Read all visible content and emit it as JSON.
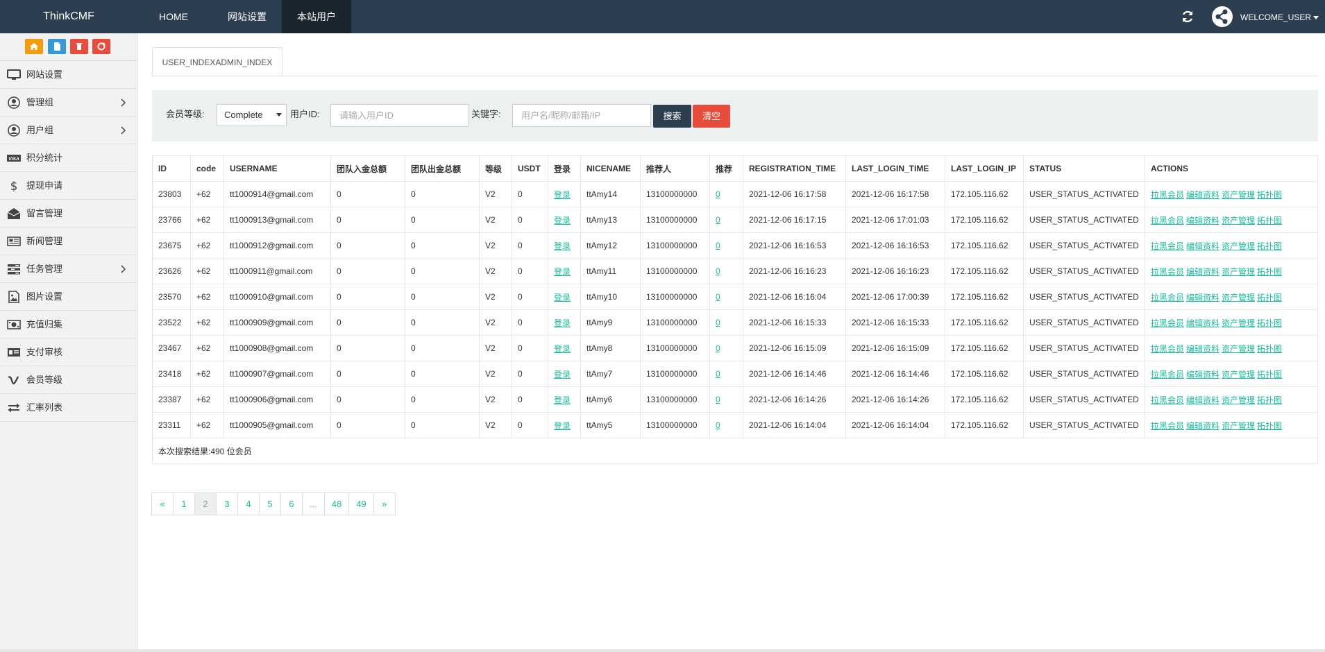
{
  "navbar": {
    "brand": "ThinkCMF",
    "items": [
      {
        "label": "HOME"
      },
      {
        "label": "网站设置"
      },
      {
        "label": "本站用户"
      }
    ],
    "welcome": "WELCOME_USER"
  },
  "shortcuts": [
    {
      "icon": "home-icon",
      "color": "#f39c12"
    },
    {
      "icon": "file-icon",
      "color": "#3498db"
    },
    {
      "icon": "trash-icon",
      "color": "#e74c3c"
    },
    {
      "icon": "recycle-icon",
      "color": "#e74c3c"
    }
  ],
  "sidebar": {
    "items": [
      {
        "label": "网站设置",
        "icon": "monitor-icon"
      },
      {
        "label": "管理组",
        "icon": "user-circle-icon"
      },
      {
        "label": "用户组",
        "icon": "user-circle-icon"
      },
      {
        "label": "积分统计",
        "icon": "visa-icon"
      },
      {
        "label": "提现申请",
        "icon": "dollar-icon"
      },
      {
        "label": "留言管理",
        "icon": "envelope-open-icon"
      },
      {
        "label": "新闻管理",
        "icon": "newspaper-icon"
      },
      {
        "label": "任务管理",
        "icon": "tasks-icon"
      },
      {
        "label": "图片设置",
        "icon": "image-icon"
      },
      {
        "label": "充值归集",
        "icon": "money-icon"
      },
      {
        "label": "支付审核",
        "icon": "id-card-icon"
      },
      {
        "label": "会员等级",
        "icon": "vimeo-icon"
      },
      {
        "label": "汇率列表",
        "icon": "exchange-icon"
      }
    ]
  },
  "tab": {
    "label": "USER_INDEXADMIN_INDEX"
  },
  "filter": {
    "level_label": "会员等级:",
    "level_value": "Complete",
    "userid_label": "用户ID:",
    "userid_placeholder": "请输入用户ID",
    "keyword_label": "关键字:",
    "keyword_placeholder": "用户名/昵称/邮箱/IP",
    "search_label": "搜索",
    "clear_label": "清空"
  },
  "table": {
    "headers": [
      "ID",
      "code",
      "USERNAME",
      "团队入金总额",
      "团队出金总额",
      "等级",
      "USDT",
      "登录",
      "NICENAME",
      "推荐人",
      "推荐",
      "REGISTRATION_TIME",
      "LAST_LOGIN_TIME",
      "LAST_LOGIN_IP",
      "STATUS",
      "ACTIONS"
    ],
    "login_link": "登录",
    "actions": [
      "拉黑会员",
      "编辑资料",
      "资产管理",
      "拓扑图"
    ],
    "rows": [
      {
        "id": "23803",
        "code": "+62",
        "username": "tt1000914@gmail.com",
        "team_in": "0",
        "team_out": "0",
        "level": "V2",
        "usdt": "0",
        "nicename": "ttAmy14",
        "referrer": "13100000000",
        "referrals": "0",
        "reg_time": "2021-12-06 16:17:58",
        "last_login": "2021-12-06 16:17:58",
        "ip": "172.105.116.62",
        "status": "USER_STATUS_ACTIVATED"
      },
      {
        "id": "23766",
        "code": "+62",
        "username": "tt1000913@gmail.com",
        "team_in": "0",
        "team_out": "0",
        "level": "V2",
        "usdt": "0",
        "nicename": "ttAmy13",
        "referrer": "13100000000",
        "referrals": "0",
        "reg_time": "2021-12-06 16:17:15",
        "last_login": "2021-12-06 17:01:03",
        "ip": "172.105.116.62",
        "status": "USER_STATUS_ACTIVATED"
      },
      {
        "id": "23675",
        "code": "+62",
        "username": "tt1000912@gmail.com",
        "team_in": "0",
        "team_out": "0",
        "level": "V2",
        "usdt": "0",
        "nicename": "ttAmy12",
        "referrer": "13100000000",
        "referrals": "0",
        "reg_time": "2021-12-06 16:16:53",
        "last_login": "2021-12-06 16:16:53",
        "ip": "172.105.116.62",
        "status": "USER_STATUS_ACTIVATED"
      },
      {
        "id": "23626",
        "code": "+62",
        "username": "tt1000911@gmail.com",
        "team_in": "0",
        "team_out": "0",
        "level": "V2",
        "usdt": "0",
        "nicename": "ttAmy11",
        "referrer": "13100000000",
        "referrals": "0",
        "reg_time": "2021-12-06 16:16:23",
        "last_login": "2021-12-06 16:16:23",
        "ip": "172.105.116.62",
        "status": "USER_STATUS_ACTIVATED"
      },
      {
        "id": "23570",
        "code": "+62",
        "username": "tt1000910@gmail.com",
        "team_in": "0",
        "team_out": "0",
        "level": "V2",
        "usdt": "0",
        "nicename": "ttAmy10",
        "referrer": "13100000000",
        "referrals": "0",
        "reg_time": "2021-12-06 16:16:04",
        "last_login": "2021-12-06 17:00:39",
        "ip": "172.105.116.62",
        "status": "USER_STATUS_ACTIVATED"
      },
      {
        "id": "23522",
        "code": "+62",
        "username": "tt1000909@gmail.com",
        "team_in": "0",
        "team_out": "0",
        "level": "V2",
        "usdt": "0",
        "nicename": "ttAmy9",
        "referrer": "13100000000",
        "referrals": "0",
        "reg_time": "2021-12-06 16:15:33",
        "last_login": "2021-12-06 16:15:33",
        "ip": "172.105.116.62",
        "status": "USER_STATUS_ACTIVATED"
      },
      {
        "id": "23467",
        "code": "+62",
        "username": "tt1000908@gmail.com",
        "team_in": "0",
        "team_out": "0",
        "level": "V2",
        "usdt": "0",
        "nicename": "ttAmy8",
        "referrer": "13100000000",
        "referrals": "0",
        "reg_time": "2021-12-06 16:15:09",
        "last_login": "2021-12-06 16:15:09",
        "ip": "172.105.116.62",
        "status": "USER_STATUS_ACTIVATED"
      },
      {
        "id": "23418",
        "code": "+62",
        "username": "tt1000907@gmail.com",
        "team_in": "0",
        "team_out": "0",
        "level": "V2",
        "usdt": "0",
        "nicename": "ttAmy7",
        "referrer": "13100000000",
        "referrals": "0",
        "reg_time": "2021-12-06 16:14:46",
        "last_login": "2021-12-06 16:14:46",
        "ip": "172.105.116.62",
        "status": "USER_STATUS_ACTIVATED"
      },
      {
        "id": "23387",
        "code": "+62",
        "username": "tt1000906@gmail.com",
        "team_in": "0",
        "team_out": "0",
        "level": "V2",
        "usdt": "0",
        "nicename": "ttAmy6",
        "referrer": "13100000000",
        "referrals": "0",
        "reg_time": "2021-12-06 16:14:26",
        "last_login": "2021-12-06 16:14:26",
        "ip": "172.105.116.62",
        "status": "USER_STATUS_ACTIVATED"
      },
      {
        "id": "23311",
        "code": "+62",
        "username": "tt1000905@gmail.com",
        "team_in": "0",
        "team_out": "0",
        "level": "V2",
        "usdt": "0",
        "nicename": "ttAmy5",
        "referrer": "13100000000",
        "referrals": "0",
        "reg_time": "2021-12-06 16:14:04",
        "last_login": "2021-12-06 16:14:04",
        "ip": "172.105.116.62",
        "status": "USER_STATUS_ACTIVATED"
      }
    ],
    "summary": "本次搜索结果:490 位会员"
  },
  "pagination": [
    {
      "label": "«",
      "state": "normal"
    },
    {
      "label": "1",
      "state": "normal"
    },
    {
      "label": "2",
      "state": "active"
    },
    {
      "label": "3",
      "state": "normal"
    },
    {
      "label": "4",
      "state": "normal"
    },
    {
      "label": "5",
      "state": "normal"
    },
    {
      "label": "6",
      "state": "normal"
    },
    {
      "label": "...",
      "state": "disabled"
    },
    {
      "label": "48",
      "state": "normal"
    },
    {
      "label": "49",
      "state": "normal"
    },
    {
      "label": "»",
      "state": "normal"
    }
  ],
  "colors": {
    "navbar": "#2c3e50",
    "navbar_active": "#1a252f",
    "link": "#18bc9c",
    "search_button": "#2c3e50",
    "clear_button": "#e74c3c",
    "filter_bg": "#ecf0f1"
  }
}
